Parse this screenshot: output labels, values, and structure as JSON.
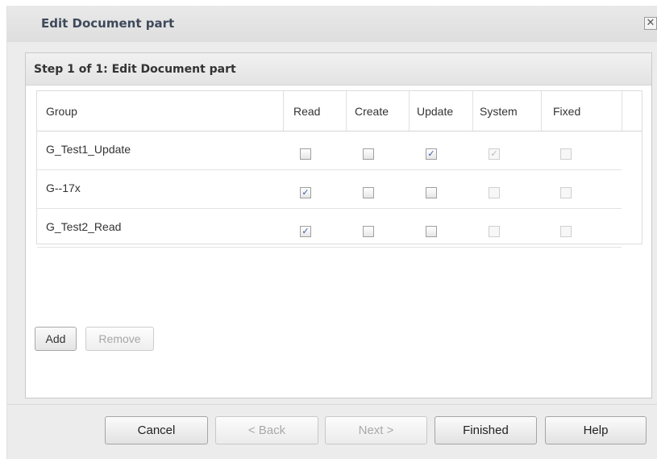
{
  "dialog": {
    "title": "Edit Document part",
    "close_glyph": "✕"
  },
  "step": {
    "title": "Step 1 of 1: Edit Document part"
  },
  "grid": {
    "headers": [
      "Group",
      "Read",
      "Create",
      "Update",
      "System",
      "Fixed"
    ],
    "rows": [
      {
        "group": "G_Test1_Update",
        "read": false,
        "create": false,
        "update": true,
        "system": true,
        "fixed": false
      },
      {
        "group": "G--17x",
        "read": true,
        "create": false,
        "update": false,
        "system": false,
        "fixed": false
      },
      {
        "group": "G_Test2_Read",
        "read": true,
        "create": false,
        "update": false,
        "system": false,
        "fixed": false
      }
    ],
    "check_glyph": "✓"
  },
  "actions": {
    "add_label": "Add",
    "remove_label": "Remove"
  },
  "footer": {
    "cancel_label": "Cancel",
    "back_label": "< Back",
    "next_label": "Next >",
    "finished_label": "Finished",
    "help_label": "Help"
  }
}
